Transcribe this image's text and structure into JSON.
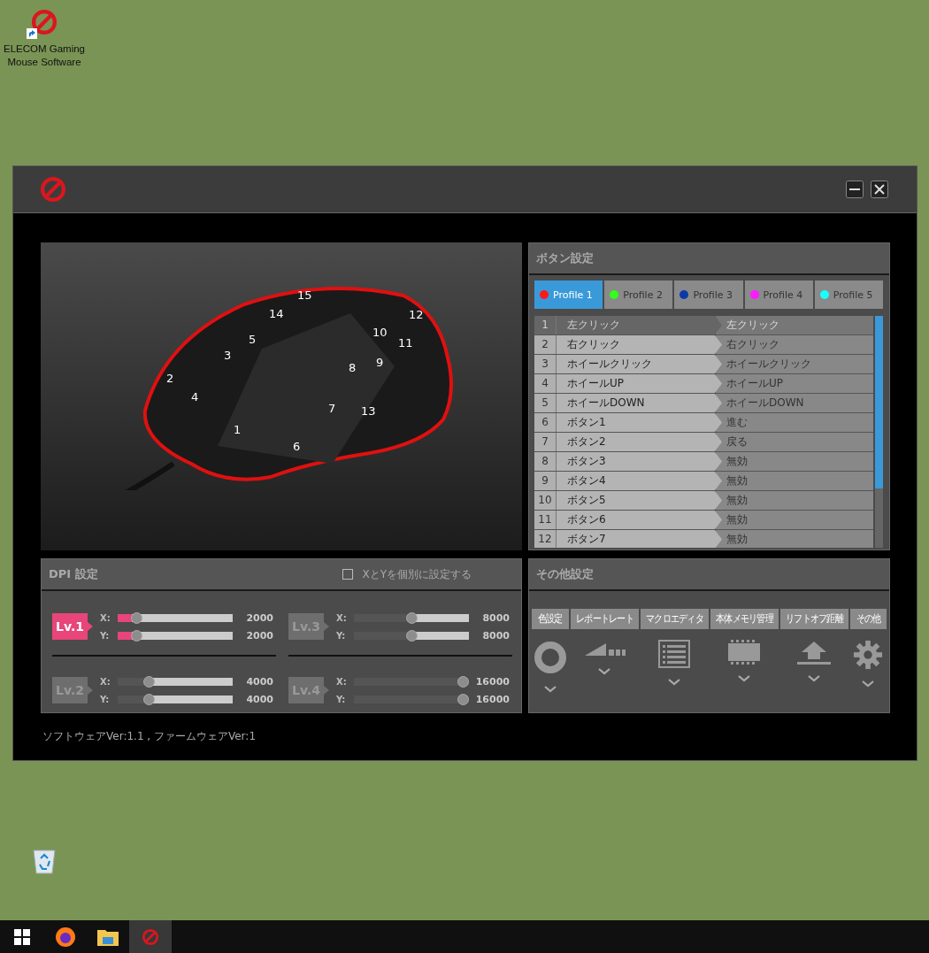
{
  "desktop": {
    "shortcut_label": "ELECOM Gaming Mouse Software"
  },
  "mouse_labels": [
    "15",
    "14",
    "12",
    "5",
    "10",
    "11",
    "3",
    "8",
    "9",
    "2",
    "4",
    "7",
    "13",
    "1",
    "6"
  ],
  "button_settings": {
    "title": "ボタン設定",
    "profiles": [
      {
        "label": "Profile 1",
        "color": "#ff1a1a",
        "selected": true
      },
      {
        "label": "Profile 2",
        "color": "#33ff1a",
        "selected": false
      },
      {
        "label": "Profile 3",
        "color": "#0a3aa8",
        "selected": false
      },
      {
        "label": "Profile 4",
        "color": "#ff1aff",
        "selected": false
      },
      {
        "label": "Profile 5",
        "color": "#1affff",
        "selected": false
      }
    ],
    "rows": [
      {
        "number": "1",
        "button": "左クリック",
        "assignment": "左クリック",
        "disabled": true
      },
      {
        "number": "2",
        "button": "右クリック",
        "assignment": "右クリック",
        "disabled": false
      },
      {
        "number": "3",
        "button": "ホイールクリック",
        "assignment": "ホイールクリック",
        "disabled": false
      },
      {
        "number": "4",
        "button": "ホイールUP",
        "assignment": "ホイールUP",
        "disabled": false
      },
      {
        "number": "5",
        "button": "ホイールDOWN",
        "assignment": "ホイールDOWN",
        "disabled": false
      },
      {
        "number": "6",
        "button": "ボタン1",
        "assignment": "進む",
        "disabled": false
      },
      {
        "number": "7",
        "button": "ボタン2",
        "assignment": "戻る",
        "disabled": false
      },
      {
        "number": "8",
        "button": "ボタン3",
        "assignment": "無効",
        "disabled": false
      },
      {
        "number": "9",
        "button": "ボタン4",
        "assignment": "無効",
        "disabled": false
      },
      {
        "number": "10",
        "button": "ボタン5",
        "assignment": "無効",
        "disabled": false
      },
      {
        "number": "11",
        "button": "ボタン6",
        "assignment": "無効",
        "disabled": false
      },
      {
        "number": "12",
        "button": "ボタン7",
        "assignment": "無効",
        "disabled": false
      }
    ]
  },
  "dpi_settings": {
    "title": "DPI 設定",
    "separate_xy": {
      "label": "XとYを個別に設定する",
      "checked": false
    },
    "levels": [
      {
        "label": "Lv.1",
        "selected": true,
        "x": {
          "label": "X:",
          "level": 0.125,
          "reading": "2000"
        },
        "y": {
          "label": "Y:",
          "level": 0.125,
          "reading": "2000"
        }
      },
      {
        "label": "Lv.3",
        "selected": false,
        "x": {
          "label": "X:",
          "level": 0.5,
          "reading": "8000"
        },
        "y": {
          "label": "Y:",
          "level": 0.5,
          "reading": "8000"
        }
      },
      {
        "label": "Lv.2",
        "selected": false,
        "x": {
          "label": "X:",
          "level": 0.25,
          "reading": "4000"
        },
        "y": {
          "label": "Y:",
          "level": 0.25,
          "reading": "4000"
        }
      },
      {
        "label": "Lv.4",
        "selected": false,
        "x": {
          "label": "X:",
          "level": 1,
          "reading": "16000"
        },
        "y": {
          "label": "Y:",
          "level": 1,
          "reading": "16000"
        }
      }
    ]
  },
  "other_settings": {
    "title": "その他設定",
    "items": [
      "色設定",
      "レポートレート",
      "マクロエディタ",
      "本体メモリ管理",
      "リフトオフ距離",
      "その他"
    ]
  },
  "version": "ソフトウェアVer:1.1 , ファームウェアVer:1",
  "taskbar": {
    "apps": [
      {
        "selected": false
      },
      {
        "selected": false
      },
      {
        "selected": true
      }
    ]
  }
}
